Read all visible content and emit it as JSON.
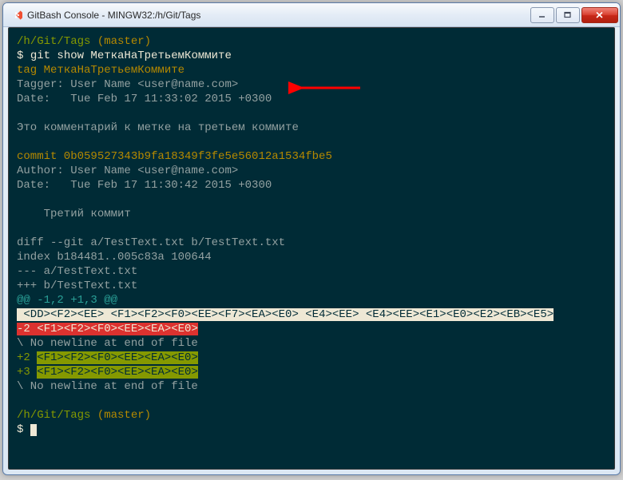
{
  "window": {
    "title": "GitBash Console - MINGW32:/h/Git/Tags"
  },
  "prompt1": {
    "path": "/h/Git/Tags",
    "branch": " (master)",
    "cmd_prompt": "$ ",
    "cmd": "git show МеткаНаТретьемКоммите"
  },
  "tag_line": "tag МеткаНаТретьемКоммите",
  "tagger": "Tagger: User Name <user@name.com>",
  "tag_date": "Date:   Tue Feb 17 11:33:02 2015 +0300",
  "tag_msg": "Это комментарий к метке на третьем коммите",
  "commit_line": "commit 0b059527343b9fa18349f3fe5e56012a1534fbe5",
  "author": "Author: User Name <user@name.com>",
  "commit_date": "Date:   Tue Feb 17 11:30:42 2015 +0300",
  "commit_msg": "    Третий коммит",
  "diff1": "diff --git a/TestText.txt b/TestText.txt",
  "diff2": "index b184481..005c83a 100644",
  "diff3": "--- a/TestText.txt",
  "diff4": "+++ b/TestText.txt",
  "hunk": "@@ -1,2 +1,3 @@",
  "ctx_seg1": " <DD><F2><EE> ",
  "ctx_seg2": "<F1><F2><F0><EE><F7><EA><E0> ",
  "ctx_seg3": "<E4><EE> ",
  "ctx_seg4": "<E4><EE><E1><E0><E2><EB><E5>",
  "del_pre": "-2 ",
  "del_hl": "<F1><F2><F0><EE><EA><E0>",
  "nonl": "\\ No newline at end of file",
  "add1_pre": "+2 ",
  "add_hl": "<F1><F2><F0><EE><EA><E0>",
  "add2_pre": "+3 ",
  "prompt2": {
    "path": "/h/Git/Tags",
    "branch": " (master)",
    "cmd_prompt": "$ "
  }
}
